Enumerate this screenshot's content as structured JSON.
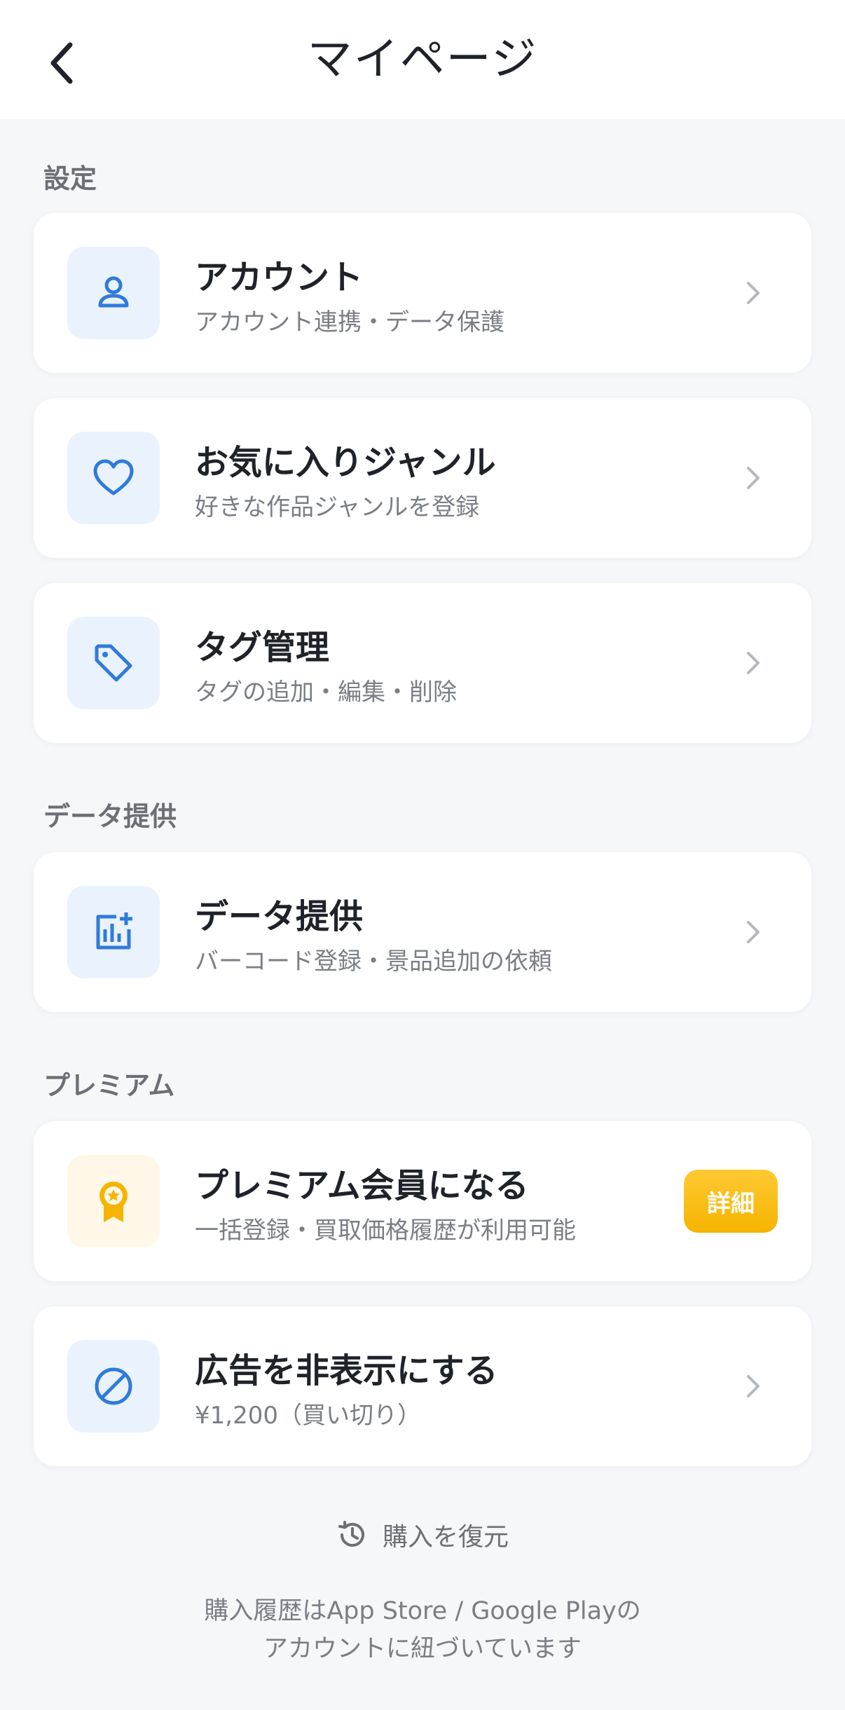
{
  "header": {
    "title": "マイページ"
  },
  "sections": {
    "settings_label": "設定",
    "data_label": "データ提供",
    "premium_label": "プレミアム"
  },
  "items": {
    "account": {
      "title": "アカウント",
      "subtitle": "アカウント連携・データ保護"
    },
    "genre": {
      "title": "お気に入りジャンル",
      "subtitle": "好きな作品ジャンルを登録"
    },
    "tags": {
      "title": "タグ管理",
      "subtitle": "タグの追加・編集・削除"
    },
    "data": {
      "title": "データ提供",
      "subtitle": "バーコード登録・景品追加の依頼"
    },
    "premium": {
      "title": "プレミアム会員になる",
      "subtitle": "一括登録・買取価格履歴が利用可能",
      "button": "詳細"
    },
    "ads": {
      "title": "広告を非表示にする",
      "subtitle": "¥1,200（買い切り）"
    }
  },
  "restore": {
    "label": "購入を復元"
  },
  "footer": {
    "line1": "購入履歴はApp Store / Google Playの",
    "line2": "アカウントに紐づいています"
  },
  "colors": {
    "accent": "#2f7bdc",
    "premium": "#f5b400",
    "background": "#f6f7f9"
  }
}
